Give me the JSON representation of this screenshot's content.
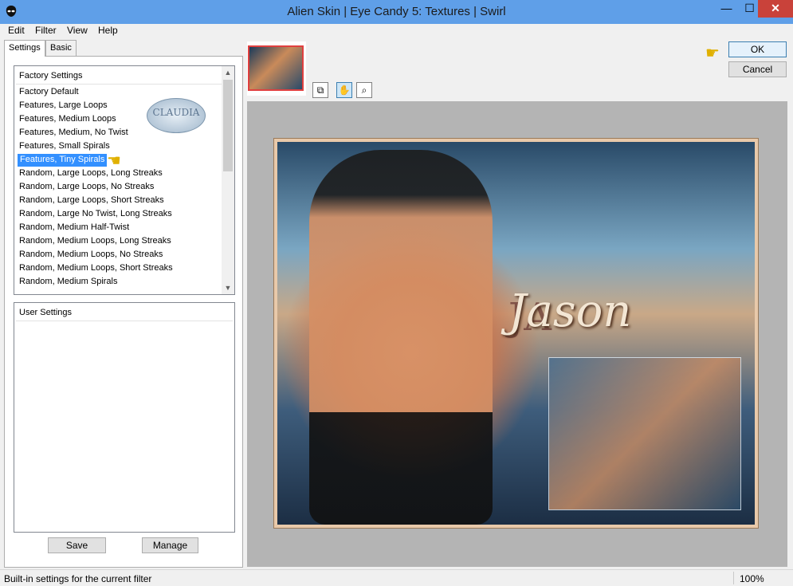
{
  "window": {
    "title": "Alien Skin | Eye Candy 5: Textures | Swirl",
    "minimize": "—",
    "maximize": "☐",
    "close": "✕"
  },
  "menu": [
    "Edit",
    "Filter",
    "View",
    "Help"
  ],
  "tabs": [
    "Settings",
    "Basic"
  ],
  "factory": {
    "header": "Factory Settings",
    "items": [
      "Factory Default",
      "Features, Large Loops",
      "Features, Medium Loops",
      "Features, Medium, No Twist",
      "Features, Small Spirals",
      "Features, Tiny Spirals",
      "Random, Large Loops, Long Streaks",
      "Random, Large Loops, No Streaks",
      "Random, Large Loops, Short Streaks",
      "Random, Large No Twist, Long Streaks",
      "Random, Medium Half-Twist",
      "Random, Medium Loops, Long Streaks",
      "Random, Medium Loops, No Streaks",
      "Random, Medium Loops, Short Streaks",
      "Random, Medium Spirals"
    ],
    "selected": "Features, Tiny Spirals"
  },
  "user": {
    "header": "User Settings"
  },
  "buttons": {
    "save": "Save",
    "manage": "Manage",
    "ok": "OK",
    "cancel": "Cancel"
  },
  "preview": {
    "title_word": "Jason",
    "bg_letters": "JA"
  },
  "watermark": "CLAUDIA",
  "status": {
    "text": "Built-in settings for the current filter",
    "zoom": "100%"
  },
  "colors": {
    "titlebar": "#5f9fe8",
    "selection": "#3390ff",
    "close": "#c9423a"
  }
}
